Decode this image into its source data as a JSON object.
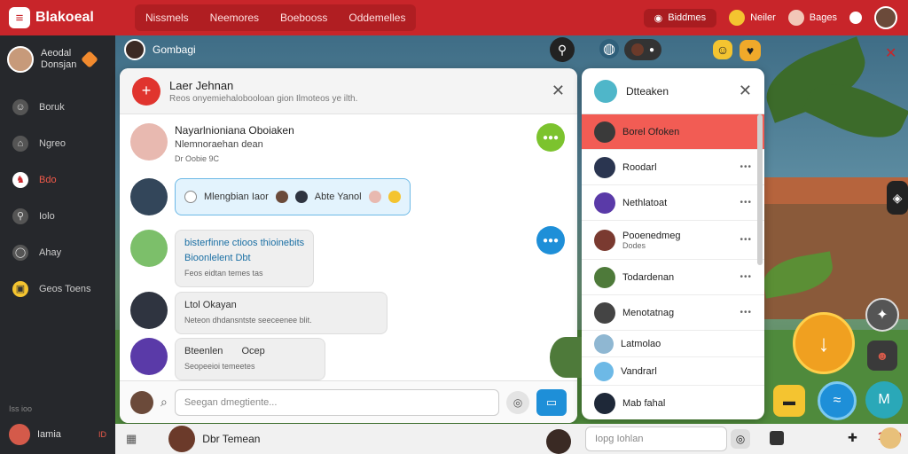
{
  "app": {
    "logo_text": "Blakoeal"
  },
  "topnav": [
    "Nissmels",
    "Neemores",
    "Boebooss",
    "Oddemelles"
  ],
  "topright": {
    "pill_label": "Biddmes",
    "coin_label": "Neiler",
    "user_label": "Bages"
  },
  "sidebar": {
    "profile": {
      "name_line1": "Aeodal",
      "name_line2": "Donsjan"
    },
    "items": [
      {
        "label": "Boruk",
        "icon": "person-icon"
      },
      {
        "label": "Ngreo",
        "icon": "home-icon"
      },
      {
        "label": "Bdo",
        "icon": "game-icon",
        "active": true
      },
      {
        "label": "Iolo",
        "icon": "search-icon"
      },
      {
        "label": "Ahay",
        "icon": "chat-icon"
      },
      {
        "label": "Geos Toens",
        "icon": "coin-icon"
      }
    ],
    "bottom_small": "Iss ioo",
    "bottom_user": "Iamia",
    "bottom_badge": "ID"
  },
  "header_strip": {
    "label": "Gombagi"
  },
  "chat": {
    "title": "Laer Jehnan",
    "subtitle": "Reos onyemiehalobooloan gion Ilmoteos ye ilth.",
    "messages": [
      {
        "line1": "Nayarlnioniana Oboiaken",
        "line2": "Nlemnoraehan dean",
        "line3": "Dr Oobie 9C"
      },
      {
        "line1": "Mlengbian Iaor",
        "line2": "Abte Yanol"
      },
      {
        "line1": "bisterfinne ctioos thioinebits",
        "line2": "Bioonlelent Dbt",
        "line3": "Feos eidtan temes tas"
      },
      {
        "line1": "Ltol Okayan",
        "line2": "Neteon dhdansntste seeceenee blit."
      },
      {
        "line1": "Bteenlen",
        "line2": "Ocep",
        "line3": "Seopeeioi temeetes"
      }
    ],
    "composer_placeholder": "Seegan dmegtiente...",
    "side_badge_green": "●●●"
  },
  "contacts": {
    "title": "Dtteaken",
    "rows": [
      {
        "name": "Borel Ofoken",
        "active": true
      },
      {
        "name": "Roodarl"
      },
      {
        "name": "Nethlatoat"
      },
      {
        "name": "Pooenedmeg",
        "sub": "Dodes"
      },
      {
        "name": "Todardenan"
      },
      {
        "name": "Menotatnag"
      },
      {
        "name": "Latmolao"
      },
      {
        "name": "Vandrarl"
      },
      {
        "name": "Mab fahal"
      }
    ]
  },
  "bottombar": {
    "title": "Dbr Temean",
    "search_placeholder": "Iopg Iohlan",
    "score": "1550"
  },
  "colors": {
    "accent": "#c8252a",
    "blue": "#1e8fd8",
    "green": "#7cc32e"
  }
}
